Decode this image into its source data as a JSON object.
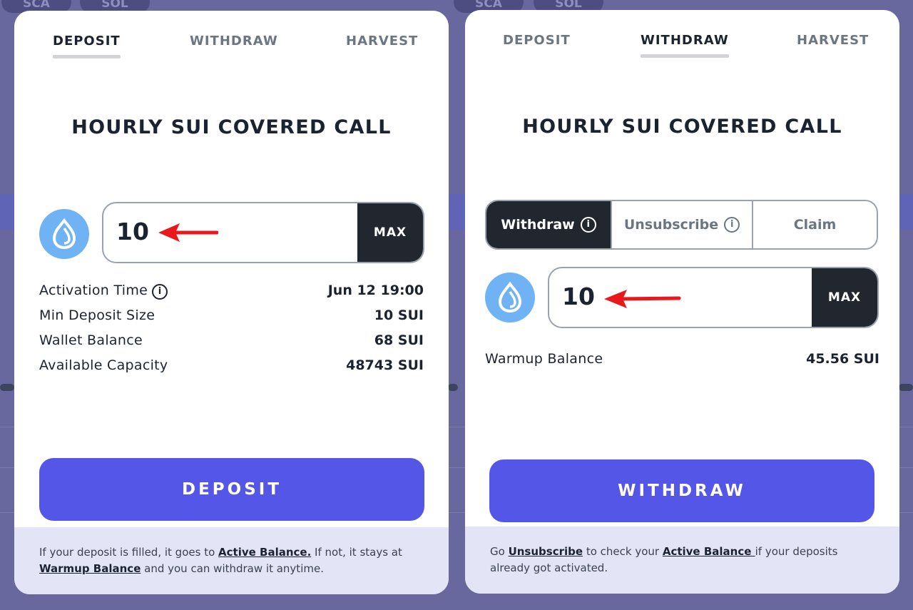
{
  "background": {
    "pills": [
      "SCA",
      "SOL"
    ]
  },
  "deposit_panel": {
    "tabs": [
      "DEPOSIT",
      "WITHDRAW",
      "HARVEST"
    ],
    "active_tab": "DEPOSIT",
    "title": "HOURLY SUI COVERED CALL",
    "coin_icon": "sui-drop-icon",
    "amount": "10",
    "max_label": "MAX",
    "info": [
      {
        "label": "Activation Time",
        "value": "Jun 12 19:00",
        "has_info_icon": true
      },
      {
        "label": "Min Deposit Size",
        "value": "10 SUI"
      },
      {
        "label": "Wallet Balance",
        "value": "68 SUI"
      },
      {
        "label": "Available Capacity",
        "value": "48743 SUI"
      }
    ],
    "button_label": "DEPOSIT",
    "footer": {
      "text1": "If your deposit is filled, it goes to ",
      "link1": "Active Balance.",
      "text2": " If not, it stays at ",
      "link2": "Warmup Balance",
      "text3": " and you can withdraw it anytime."
    }
  },
  "withdraw_panel": {
    "tabs": [
      "DEPOSIT",
      "WITHDRAW",
      "HARVEST"
    ],
    "active_tab": "WITHDRAW",
    "title": "HOURLY SUI COVERED CALL",
    "segments": [
      "Withdraw",
      "Unsubscribe",
      "Claim"
    ],
    "active_segment": "Withdraw",
    "coin_icon": "sui-drop-icon",
    "amount": "10",
    "max_label": "MAX",
    "info": [
      {
        "label": "Warmup Balance",
        "value": "45.56 SUI"
      }
    ],
    "button_label": "WITHDRAW",
    "footer": {
      "text1": "Go ",
      "link1": "Unsubscribe",
      "text2": " to check your ",
      "link2": "Active Balance ",
      "text3": "if your deposits already got activated."
    }
  },
  "colors": {
    "accent": "#5356e6",
    "dark": "#22272f",
    "coin": "#6fb3f4",
    "arrow": "#e8181d",
    "footer_bg": "#e4e4f7"
  }
}
